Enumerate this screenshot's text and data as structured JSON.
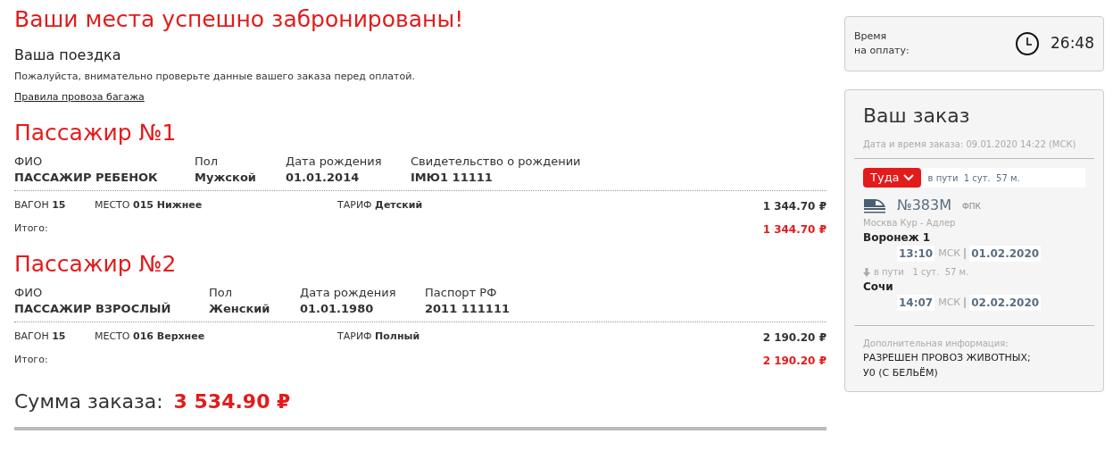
{
  "title": "Ваши места успешно забронированы!",
  "trip": {
    "heading": "Ваша поездка",
    "note": "Пожалуйста, внимательно проверьте данные вашего заказа перед оплатой.",
    "link": "Правила провоза багажа"
  },
  "passengers": [
    {
      "title": "Пассажир №1",
      "fields": [
        {
          "label": "ФИО",
          "value": "ПАССАЖИР РЕБЕНОК"
        },
        {
          "label": "Пол",
          "value": "Мужской"
        },
        {
          "label": "Дата рождения",
          "value": "01.01.2014"
        },
        {
          "label": "Свидетельство о рождении",
          "value": "IМЮ1 11111"
        }
      ],
      "wagon_label": "ВАГОН",
      "wagon": "15",
      "seat_label": "МЕСТО",
      "seat": "015 Нижнее",
      "tariff_label": "ТАРИФ",
      "tariff": "Детский",
      "price": "1 344.70 ₽",
      "total_label": "Итого:",
      "total": "1 344.70 ₽"
    },
    {
      "title": "Пассажир №2",
      "fields": [
        {
          "label": "ФИО",
          "value": "ПАССАЖИР ВЗРОСЛЫЙ"
        },
        {
          "label": "Пол",
          "value": "Женский"
        },
        {
          "label": "Дата рождения",
          "value": "01.01.1980"
        },
        {
          "label": "Паспорт РФ",
          "value": "2011 111111"
        }
      ],
      "wagon_label": "ВАГОН",
      "wagon": "15",
      "seat_label": "МЕСТО",
      "seat": "016 Верхнее",
      "tariff_label": "ТАРИФ",
      "tariff": "Полный",
      "price": "2 190.20 ₽",
      "total_label": "Итого:",
      "total": "2 190.20 ₽"
    }
  ],
  "order_sum": {
    "label": "Сумма заказа:",
    "value": "3 534.90 ₽"
  },
  "timer": {
    "label_1": "Время",
    "label_2": "на оплату:",
    "value": "26:48"
  },
  "order": {
    "title": "Ваш заказ",
    "date": "Дата и время заказа: 09.01.2020 14:22 (МСК)",
    "direction": "Туда",
    "travel_time": "в пути  1 сут.  57 м.",
    "train": "№383М",
    "carrier": "ФПК",
    "route": "Москва Кур - Адлер",
    "departure": {
      "station": "Воронеж 1",
      "time": "13:10",
      "tz": "МСК",
      "date": "01.02.2020"
    },
    "duration": "в пути   1 сут.  57 м.",
    "arrival": {
      "station": "Сочи",
      "time": "14:07",
      "tz": "МСК",
      "date": "02.02.2020"
    },
    "extra_label": "Дополнительная информация:",
    "extra_lines": [
      "РАЗРЕШЕН ПРОВОЗ ЖИВОТНЫХ;",
      "У0 (С БЕЛЬЁМ)"
    ]
  }
}
